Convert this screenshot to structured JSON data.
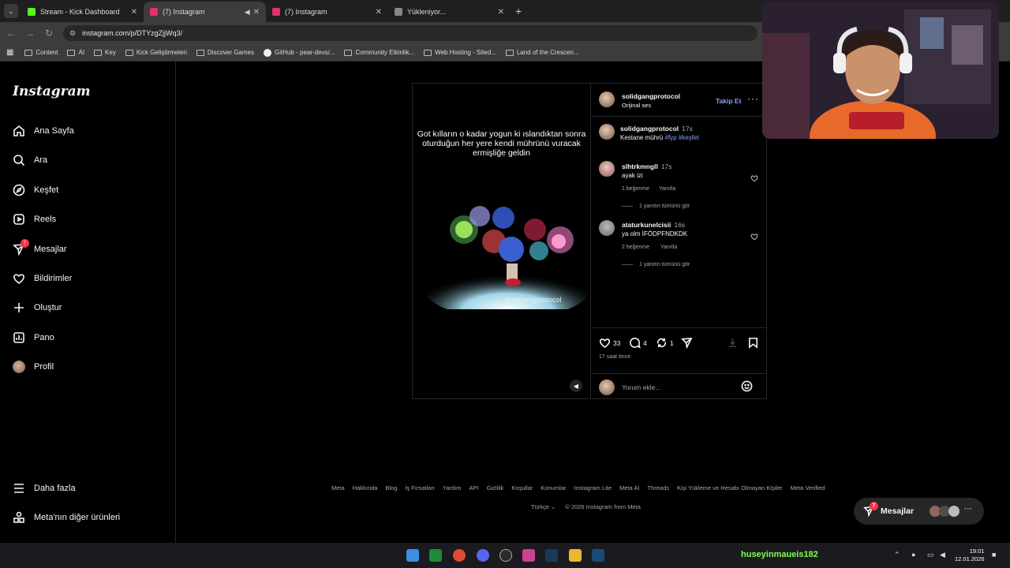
{
  "browser": {
    "tabs": [
      {
        "label": "Stream - Kick Dashboard",
        "color": "#53fc18",
        "active": false,
        "audio": false
      },
      {
        "label": "(7) Instagram",
        "color": "#e1306c",
        "active": true,
        "audio": true
      },
      {
        "label": "(7) Instagram",
        "color": "#e1306c",
        "active": false,
        "audio": false
      },
      {
        "label": "Yükleniyor...",
        "color": "#888888",
        "active": false,
        "audio": false
      }
    ],
    "url": "instagram.com/p/DTYzgZjjWq3/",
    "bookmarks": [
      "Content",
      "AI",
      "Key",
      "Kick Geliştirmeleri",
      "Discover Games",
      "GitHub - pear-devs/...",
      "Community Etkinlik...",
      "Web Hosting - Sited...",
      "Land of the Crescen..."
    ]
  },
  "sidebar": {
    "logo": "Instagram",
    "items": [
      {
        "label": "Ana Sayfa",
        "icon": "home-icon"
      },
      {
        "label": "Ara",
        "icon": "search-icon"
      },
      {
        "label": "Keşfet",
        "icon": "compass-icon"
      },
      {
        "label": "Reels",
        "icon": "reels-icon"
      },
      {
        "label": "Mesajlar",
        "icon": "messenger-icon",
        "badge": "7"
      },
      {
        "label": "Bildirimler",
        "icon": "heart-icon"
      },
      {
        "label": "Oluştur",
        "icon": "plus-icon"
      },
      {
        "label": "Pano",
        "icon": "dashboard-icon"
      },
      {
        "label": "Profil",
        "icon": "avatar"
      }
    ],
    "more": "Daha fazla",
    "meta_products": "Meta'nın diğer ürünleri"
  },
  "post": {
    "overlay_text": "Got kılların o kadar yogun ki ıslandıktan sonra oturduğun her yere kendi mührünü vuracak ermişliğe geldin",
    "watermark": "solidgangprotocol",
    "author": "solidgangprotocol",
    "audio": "Orijinal ses",
    "follow": "Takip Et",
    "caption": {
      "user": "solidgangprotocol",
      "time": "17s",
      "text": "Kestane mührü",
      "tags": "#fyp #keşfet"
    },
    "comments": [
      {
        "user": "slhtrkmngll",
        "time": "17s",
        "text": "ayak izi",
        "likes": "1 beğenme",
        "reply": "Yanıtla",
        "view_replies": "1 yanıtın tümünü gör"
      },
      {
        "user": "ataturkunelcisii",
        "time": "16s",
        "text": "ya olm İFÖDPFNDKDK",
        "likes": "2 beğenme",
        "reply": "Yanıtla",
        "view_replies": "1 yanıtın tümünü gör"
      }
    ],
    "like_count": "33",
    "comment_count": "4",
    "repost_count": "1",
    "posted": "17 saat önce",
    "comment_placeholder": "Yorum ekle..."
  },
  "footer": {
    "links": [
      "Meta",
      "Hakkında",
      "Blog",
      "İş Fırsatları",
      "Yardım",
      "API",
      "Gizlilik",
      "Koşullar",
      "Konumlar",
      "Instagram Lite",
      "Meta AI",
      "Threads",
      "Kişi Yükleme ve Hesabı Olmayan Kişiler",
      "Meta Verified"
    ],
    "language": "Türkçe",
    "copyright": "© 2026 Instagram from Meta"
  },
  "messages_pill": {
    "label": "Mesajlar",
    "badge": "7"
  },
  "taskbar": {
    "username": "huseyinmaueis182",
    "time": "19:01",
    "date": "12.01.2026"
  }
}
